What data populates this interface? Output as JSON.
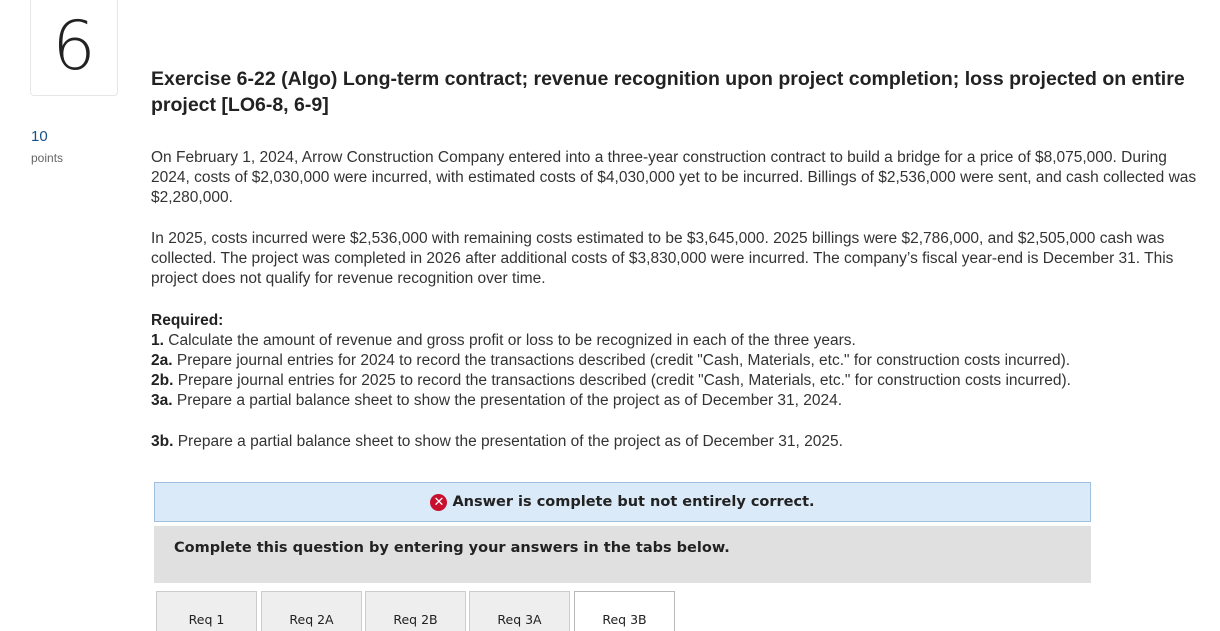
{
  "question": {
    "number": "6",
    "points_value": "10",
    "points_label": "points"
  },
  "exercise": {
    "title": "Exercise 6-22 (Algo) Long-term contract; revenue recognition upon project completion; loss projected on entire project [LO6-8, 6-9]",
    "paragraph1": "On February 1, 2024, Arrow Construction Company entered into a three-year construction contract to build a bridge for a price of $8,075,000. During 2024, costs of $2,030,000 were incurred, with estimated costs of $4,030,000 yet to be incurred. Billings of $2,536,000 were sent, and cash collected was $2,280,000.",
    "paragraph2": "In 2025, costs incurred were $2,536,000 with remaining costs estimated to be $3,645,000. 2025 billings were $2,786,000, and $2,505,000 cash was collected. The project was completed in 2026 after additional costs of $3,830,000 were incurred. The company’s fiscal year-end is December 31. This project does not qualify for revenue recognition over time.",
    "required_heading": "Required:",
    "requirements": [
      {
        "num": "1.",
        "text": "Calculate the amount of revenue and gross profit or loss to be recognized in each of the three years."
      },
      {
        "num": "2a.",
        "text": "Prepare journal entries for 2024 to record the transactions described (credit \"Cash, Materials, etc.\" for construction costs incurred)."
      },
      {
        "num": "2b.",
        "text": "Prepare journal entries for 2025 to record the transactions described (credit \"Cash, Materials, etc.\" for construction costs incurred)."
      },
      {
        "num": "3a.",
        "text": "Prepare a partial balance sheet to show the presentation of the project as of December 31, 2024."
      },
      {
        "num": "3b.",
        "text": "Prepare a partial balance sheet to show the presentation of the project as of December 31, 2025."
      }
    ]
  },
  "alert": {
    "icon": "error-x-icon",
    "text": "Answer is complete but not entirely correct.",
    "color": "#c8102e"
  },
  "instructions": "Complete this question by entering your answers in the tabs below.",
  "tabs": [
    {
      "label": "Req 1",
      "active": false
    },
    {
      "label": "Req 2A",
      "active": false
    },
    {
      "label": "Req 2B",
      "active": false
    },
    {
      "label": "Req 3A",
      "active": false
    },
    {
      "label": "Req 3B",
      "active": true
    }
  ]
}
